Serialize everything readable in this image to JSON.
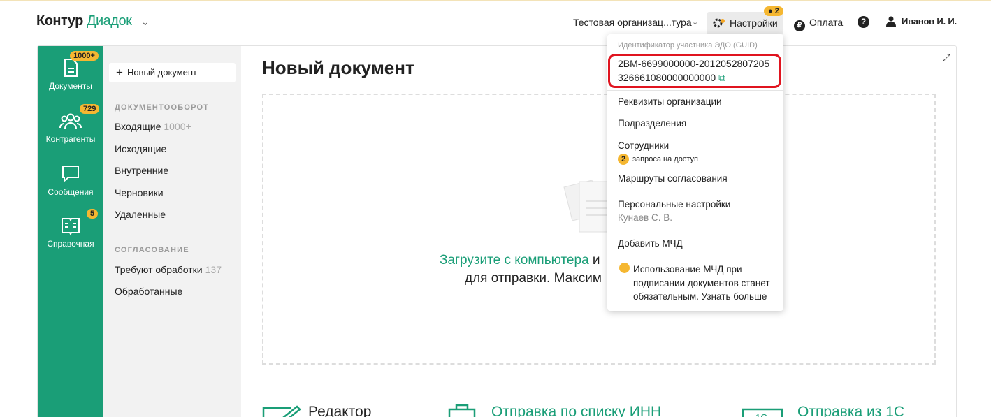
{
  "header": {
    "logo_a": "Контур",
    "logo_b": "Диадок",
    "org": "Тестовая организац...тура",
    "settings": "Настройки",
    "settings_badge": "2",
    "pay": "Оплата",
    "help": "?",
    "user": "Иванов И. И."
  },
  "rail": [
    {
      "label": "Документы",
      "badge": "1000+"
    },
    {
      "label": "Контрагенты",
      "badge": "729"
    },
    {
      "label": "Сообщения",
      "badge": ""
    },
    {
      "label": "Справочная",
      "badge": "5"
    }
  ],
  "nav": {
    "new_doc": "Новый документ",
    "section1": "ДОКУМЕНТООБОРОТ",
    "items1": [
      {
        "label": "Входящие",
        "count": "1000+"
      },
      {
        "label": "Исходящие",
        "count": ""
      },
      {
        "label": "Внутренние",
        "count": ""
      },
      {
        "label": "Черновики",
        "count": ""
      },
      {
        "label": "Удаленные",
        "count": ""
      }
    ],
    "section2": "СОГЛАСОВАНИЕ",
    "items2": [
      {
        "label": "Требуют обработки",
        "count": "137"
      },
      {
        "label": "Обработанные",
        "count": ""
      }
    ]
  },
  "main": {
    "title": "Новый документ",
    "upload_link": "Загрузите с компьютера",
    "upload_rest": " и",
    "upload_line2": "для отправки. Максим",
    "cards": [
      "Редактор",
      "Отправка по списку ИНН",
      "Отправка из 1С"
    ]
  },
  "menu": {
    "guid_caption": "Идентификатор участника ЭДО (GUID)",
    "guid_line1": "2BM-6699000000-2012052807205",
    "guid_line2": "326661080000000000",
    "requisites": "Реквизиты организации",
    "divisions": "Подразделения",
    "employees": "Сотрудники",
    "requests_count": "2",
    "requests_text": "запроса на доступ",
    "routes": "Маршруты согласования",
    "personal": "Персональные настройки",
    "personal_sub": "Кунаев С. В.",
    "add_mchd": "Добавить МЧД",
    "notice": "Использование МЧД при подписании документов станет обязательным. Узнать больше"
  },
  "colors": {
    "brand": "#1a9e77",
    "badge": "#f5b731",
    "highlight": "#e0141f"
  }
}
